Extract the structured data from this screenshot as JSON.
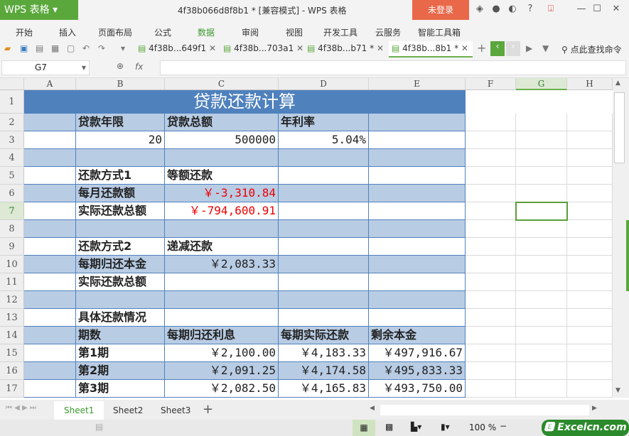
{
  "app": {
    "logo": "WPS 表格",
    "title": "4f38b066d8f8b1 * [兼容模式] - WPS 表格",
    "login": "未登录"
  },
  "menu": [
    "开始",
    "插入",
    "页面布局",
    "公式",
    "数据",
    "审阅",
    "视图",
    "开发工具",
    "云服务",
    "智能工具箱"
  ],
  "active_menu": 4,
  "doc_tabs": [
    "4f38b...649f1",
    "4f38b...703a1",
    "4f38b...b71 *",
    "4f38b...8b1 *"
  ],
  "active_doc_tab": 3,
  "search_cmd": "点此查找命令",
  "formula": {
    "namebox": "G7",
    "fx": "fx",
    "value": ""
  },
  "columns": [
    "A",
    "B",
    "C",
    "D",
    "E",
    "F",
    "G",
    "H"
  ],
  "selected_col": 6,
  "rows": [
    "1",
    "2",
    "3",
    "4",
    "5",
    "6",
    "7",
    "8",
    "9",
    "10",
    "11",
    "12",
    "13",
    "14",
    "15",
    "16",
    "17"
  ],
  "selected_row": 6,
  "title": "贷款还款计算",
  "cells": [
    [
      "",
      "贷款年限",
      "贷款总额",
      "年利率",
      ""
    ],
    [
      "",
      "20",
      "500000",
      "5.04%",
      ""
    ],
    [
      "",
      "",
      "",
      "",
      ""
    ],
    [
      "",
      "还款方式1",
      "等额还款",
      "",
      ""
    ],
    [
      "",
      "每月还款额",
      "￥-3,310.84",
      "",
      ""
    ],
    [
      "",
      "实际还款总额",
      "￥-794,600.91",
      "",
      ""
    ],
    [
      "",
      "",
      "",
      "",
      ""
    ],
    [
      "",
      "还款方式2",
      "递减还款",
      "",
      ""
    ],
    [
      "",
      "每期归还本金",
      "￥2,083.33",
      "",
      ""
    ],
    [
      "",
      "实际还款总额",
      "",
      "",
      ""
    ],
    [
      "",
      "",
      "",
      "",
      ""
    ],
    [
      "",
      "具体还款情况",
      "",
      "",
      ""
    ],
    [
      "",
      "期数",
      "每期归还利息",
      "每期实际还款",
      "剩余本金"
    ],
    [
      "",
      "第1期",
      "￥2,100.00",
      "￥4,183.33",
      "￥497,916.67"
    ],
    [
      "",
      "第2期",
      "￥2,091.25",
      "￥4,174.58",
      "￥495,833.33"
    ],
    [
      "",
      "第3期",
      "￥2,082.50",
      "￥4,165.83",
      "￥493,750.00"
    ]
  ],
  "sheets": [
    "Sheet1",
    "Sheet2",
    "Sheet3"
  ],
  "zoom": "100 %",
  "watermark": "Excelcn.com",
  "colors": {
    "title_fill": "#4f81bd",
    "band_fill": "#b8cce4",
    "accent": "#6ab04c"
  }
}
